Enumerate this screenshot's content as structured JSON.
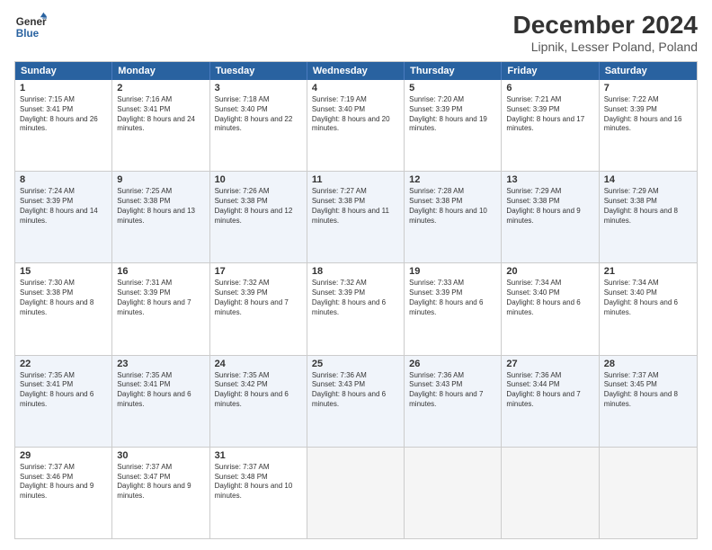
{
  "logo": {
    "line1": "General",
    "line2": "Blue"
  },
  "title": "December 2024",
  "subtitle": "Lipnik, Lesser Poland, Poland",
  "headers": [
    "Sunday",
    "Monday",
    "Tuesday",
    "Wednesday",
    "Thursday",
    "Friday",
    "Saturday"
  ],
  "weeks": [
    [
      {
        "day": "1",
        "sunrise": "Sunrise: 7:15 AM",
        "sunset": "Sunset: 3:41 PM",
        "daylight": "Daylight: 8 hours and 26 minutes."
      },
      {
        "day": "2",
        "sunrise": "Sunrise: 7:16 AM",
        "sunset": "Sunset: 3:41 PM",
        "daylight": "Daylight: 8 hours and 24 minutes."
      },
      {
        "day": "3",
        "sunrise": "Sunrise: 7:18 AM",
        "sunset": "Sunset: 3:40 PM",
        "daylight": "Daylight: 8 hours and 22 minutes."
      },
      {
        "day": "4",
        "sunrise": "Sunrise: 7:19 AM",
        "sunset": "Sunset: 3:40 PM",
        "daylight": "Daylight: 8 hours and 20 minutes."
      },
      {
        "day": "5",
        "sunrise": "Sunrise: 7:20 AM",
        "sunset": "Sunset: 3:39 PM",
        "daylight": "Daylight: 8 hours and 19 minutes."
      },
      {
        "day": "6",
        "sunrise": "Sunrise: 7:21 AM",
        "sunset": "Sunset: 3:39 PM",
        "daylight": "Daylight: 8 hours and 17 minutes."
      },
      {
        "day": "7",
        "sunrise": "Sunrise: 7:22 AM",
        "sunset": "Sunset: 3:39 PM",
        "daylight": "Daylight: 8 hours and 16 minutes."
      }
    ],
    [
      {
        "day": "8",
        "sunrise": "Sunrise: 7:24 AM",
        "sunset": "Sunset: 3:39 PM",
        "daylight": "Daylight: 8 hours and 14 minutes."
      },
      {
        "day": "9",
        "sunrise": "Sunrise: 7:25 AM",
        "sunset": "Sunset: 3:38 PM",
        "daylight": "Daylight: 8 hours and 13 minutes."
      },
      {
        "day": "10",
        "sunrise": "Sunrise: 7:26 AM",
        "sunset": "Sunset: 3:38 PM",
        "daylight": "Daylight: 8 hours and 12 minutes."
      },
      {
        "day": "11",
        "sunrise": "Sunrise: 7:27 AM",
        "sunset": "Sunset: 3:38 PM",
        "daylight": "Daylight: 8 hours and 11 minutes."
      },
      {
        "day": "12",
        "sunrise": "Sunrise: 7:28 AM",
        "sunset": "Sunset: 3:38 PM",
        "daylight": "Daylight: 8 hours and 10 minutes."
      },
      {
        "day": "13",
        "sunrise": "Sunrise: 7:29 AM",
        "sunset": "Sunset: 3:38 PM",
        "daylight": "Daylight: 8 hours and 9 minutes."
      },
      {
        "day": "14",
        "sunrise": "Sunrise: 7:29 AM",
        "sunset": "Sunset: 3:38 PM",
        "daylight": "Daylight: 8 hours and 8 minutes."
      }
    ],
    [
      {
        "day": "15",
        "sunrise": "Sunrise: 7:30 AM",
        "sunset": "Sunset: 3:38 PM",
        "daylight": "Daylight: 8 hours and 8 minutes."
      },
      {
        "day": "16",
        "sunrise": "Sunrise: 7:31 AM",
        "sunset": "Sunset: 3:39 PM",
        "daylight": "Daylight: 8 hours and 7 minutes."
      },
      {
        "day": "17",
        "sunrise": "Sunrise: 7:32 AM",
        "sunset": "Sunset: 3:39 PM",
        "daylight": "Daylight: 8 hours and 7 minutes."
      },
      {
        "day": "18",
        "sunrise": "Sunrise: 7:32 AM",
        "sunset": "Sunset: 3:39 PM",
        "daylight": "Daylight: 8 hours and 6 minutes."
      },
      {
        "day": "19",
        "sunrise": "Sunrise: 7:33 AM",
        "sunset": "Sunset: 3:39 PM",
        "daylight": "Daylight: 8 hours and 6 minutes."
      },
      {
        "day": "20",
        "sunrise": "Sunrise: 7:34 AM",
        "sunset": "Sunset: 3:40 PM",
        "daylight": "Daylight: 8 hours and 6 minutes."
      },
      {
        "day": "21",
        "sunrise": "Sunrise: 7:34 AM",
        "sunset": "Sunset: 3:40 PM",
        "daylight": "Daylight: 8 hours and 6 minutes."
      }
    ],
    [
      {
        "day": "22",
        "sunrise": "Sunrise: 7:35 AM",
        "sunset": "Sunset: 3:41 PM",
        "daylight": "Daylight: 8 hours and 6 minutes."
      },
      {
        "day": "23",
        "sunrise": "Sunrise: 7:35 AM",
        "sunset": "Sunset: 3:41 PM",
        "daylight": "Daylight: 8 hours and 6 minutes."
      },
      {
        "day": "24",
        "sunrise": "Sunrise: 7:35 AM",
        "sunset": "Sunset: 3:42 PM",
        "daylight": "Daylight: 8 hours and 6 minutes."
      },
      {
        "day": "25",
        "sunrise": "Sunrise: 7:36 AM",
        "sunset": "Sunset: 3:43 PM",
        "daylight": "Daylight: 8 hours and 6 minutes."
      },
      {
        "day": "26",
        "sunrise": "Sunrise: 7:36 AM",
        "sunset": "Sunset: 3:43 PM",
        "daylight": "Daylight: 8 hours and 7 minutes."
      },
      {
        "day": "27",
        "sunrise": "Sunrise: 7:36 AM",
        "sunset": "Sunset: 3:44 PM",
        "daylight": "Daylight: 8 hours and 7 minutes."
      },
      {
        "day": "28",
        "sunrise": "Sunrise: 7:37 AM",
        "sunset": "Sunset: 3:45 PM",
        "daylight": "Daylight: 8 hours and 8 minutes."
      }
    ],
    [
      {
        "day": "29",
        "sunrise": "Sunrise: 7:37 AM",
        "sunset": "Sunset: 3:46 PM",
        "daylight": "Daylight: 8 hours and 9 minutes."
      },
      {
        "day": "30",
        "sunrise": "Sunrise: 7:37 AM",
        "sunset": "Sunset: 3:47 PM",
        "daylight": "Daylight: 8 hours and 9 minutes."
      },
      {
        "day": "31",
        "sunrise": "Sunrise: 7:37 AM",
        "sunset": "Sunset: 3:48 PM",
        "daylight": "Daylight: 8 hours and 10 minutes."
      },
      null,
      null,
      null,
      null
    ]
  ]
}
